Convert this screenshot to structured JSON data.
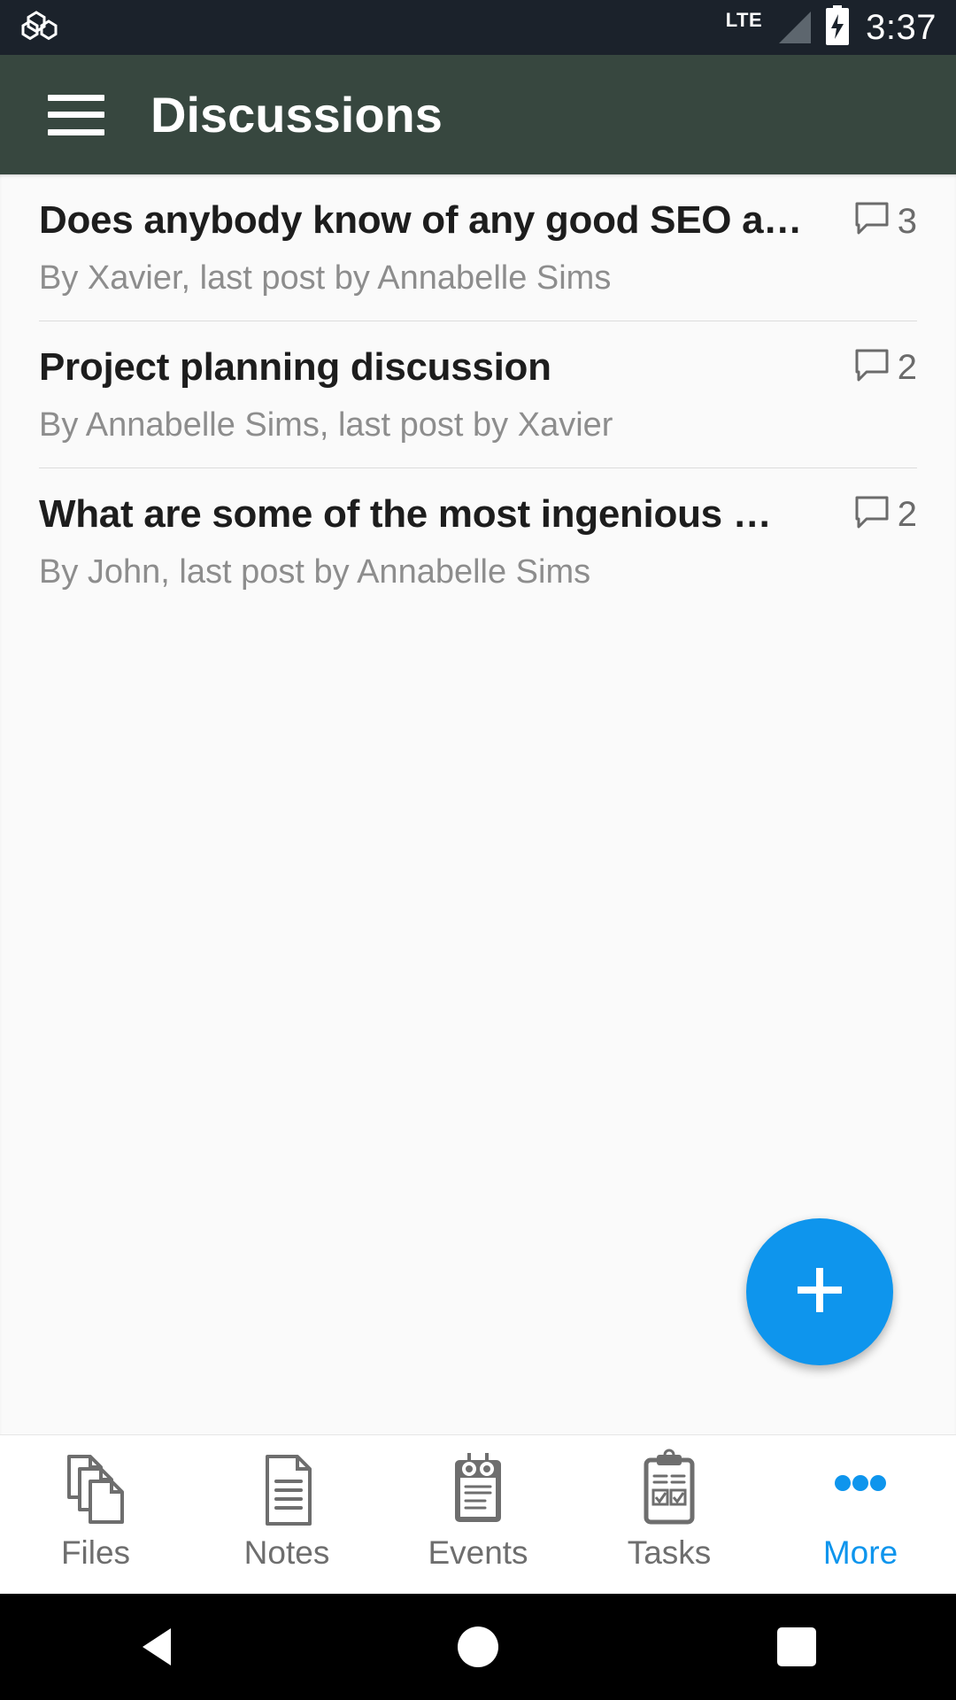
{
  "status_bar": {
    "app_icon": "hexagon-cluster-icon",
    "network": "LTE",
    "signal_icon": "signal-triangle-icon",
    "battery_icon": "battery-charging-icon",
    "time": "3:37",
    "background_color": "#1b222b"
  },
  "app_bar": {
    "menu_icon": "hamburger-menu-icon",
    "title": "Discussions",
    "background_color": "#37473f"
  },
  "discussions": [
    {
      "title": "Does anybody know of any good SEO a…",
      "subtitle": "By Xavier, last post by Annabelle Sims",
      "comment_icon": "comment-bubble-icon",
      "comment_count": "3"
    },
    {
      "title": "Project planning discussion",
      "subtitle": "By Annabelle Sims, last post by Xavier",
      "comment_icon": "comment-bubble-icon",
      "comment_count": "2"
    },
    {
      "title": "What are some of the most ingenious …",
      "subtitle": "By John, last post by Annabelle Sims",
      "comment_icon": "comment-bubble-icon",
      "comment_count": "2"
    }
  ],
  "fab": {
    "icon": "plus-icon",
    "color": "#0e95ed"
  },
  "tab_bar": {
    "accent_color": "#0e95ed",
    "inactive_color": "#6e6e6e",
    "items": [
      {
        "label": "Files",
        "icon": "files-stack-icon",
        "active": false
      },
      {
        "label": "Notes",
        "icon": "note-document-icon",
        "active": false
      },
      {
        "label": "Events",
        "icon": "calendar-icon",
        "active": false
      },
      {
        "label": "Tasks",
        "icon": "clipboard-check-icon",
        "active": false
      },
      {
        "label": "More",
        "icon": "ellipsis-icon",
        "active": true
      }
    ]
  },
  "system_nav": {
    "back": "back-triangle-icon",
    "home": "home-circle-icon",
    "recents": "recents-square-icon"
  }
}
